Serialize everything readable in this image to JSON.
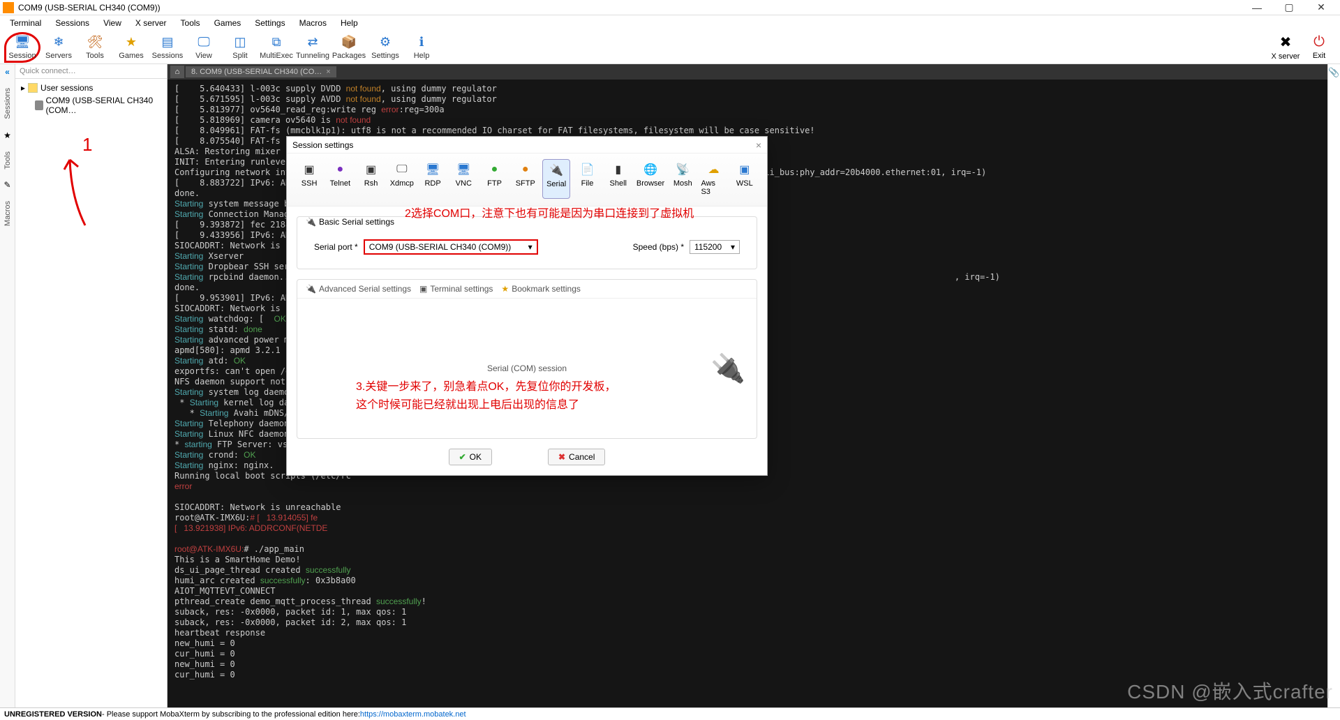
{
  "window": {
    "title": "COM9  (USB-SERIAL CH340 (COM9))"
  },
  "menu": [
    "Terminal",
    "Sessions",
    "View",
    "X server",
    "Tools",
    "Games",
    "Settings",
    "Macros",
    "Help"
  ],
  "toolbar": [
    {
      "label": "Session",
      "color": "#2a78d0"
    },
    {
      "label": "Servers",
      "color": "#2a78d0"
    },
    {
      "label": "Tools",
      "color": "#c06010"
    },
    {
      "label": "Games",
      "color": "#e0a000"
    },
    {
      "label": "Sessions",
      "color": "#2a78d0"
    },
    {
      "label": "View",
      "color": "#2a78d0"
    },
    {
      "label": "Split",
      "color": "#2a78d0"
    },
    {
      "label": "MultiExec",
      "color": "#2a78d0"
    },
    {
      "label": "Tunneling",
      "color": "#2a78d0"
    },
    {
      "label": "Packages",
      "color": "#c06010"
    },
    {
      "label": "Settings",
      "color": "#2a78d0"
    },
    {
      "label": "Help",
      "color": "#2a78d0"
    }
  ],
  "toolbar_right": [
    {
      "label": "X server",
      "color": "#000"
    },
    {
      "label": "Exit",
      "color": "#d02020"
    }
  ],
  "vtabs": [
    "Sessions",
    "Tools",
    "Macros"
  ],
  "sidebar": {
    "quick": "Quick connect…",
    "root": "User sessions",
    "child": "COM9  (USB-SERIAL CH340 (COM…"
  },
  "term_tab": "8. COM9  (USB-SERIAL CH340 (CO…",
  "statusbar": {
    "prefix": "UNREGISTERED VERSION",
    "text": " -   Please support MobaXterm by subscribing to the professional edition here: ",
    "link": "https://mobaxterm.mobatek.net"
  },
  "watermark": "CSDN @嵌入式crafter",
  "dialog": {
    "title": "Session settings",
    "protos": [
      "SSH",
      "Telnet",
      "Rsh",
      "Xdmcp",
      "RDP",
      "VNC",
      "FTP",
      "SFTP",
      "Serial",
      "File",
      "Shell",
      "Browser",
      "Mosh",
      "Aws S3",
      "WSL"
    ],
    "active_proto_index": 8,
    "group_title": "Basic Serial settings",
    "serial_port_label": "Serial port *",
    "serial_port_value": "COM9  (USB-SERIAL CH340 (COM9))",
    "speed_label": "Speed (bps) *",
    "speed_value": "115200",
    "sub_tabs": [
      "Advanced Serial settings",
      "Terminal settings",
      "Bookmark settings"
    ],
    "body_text": "Serial (COM) session",
    "ok": "OK",
    "cancel": "Cancel"
  },
  "annotations": {
    "a1": "1",
    "a2": "2选择COM口，注意下也有可能是因为串口连接到了虚拟机",
    "a3_l1": "3.关键一步来了，别急着点OK，先复位你的开发板，",
    "a3_l2": "这个时候可能已经就出现上电后出现的信息了"
  },
  "term": {
    "raw": "[    5.640433] l-003c supply DVDD |not found|, using dummy regulator\n[    5.671595] l-003c supply AVDD |not found|, using dummy regulator\n[    5.813977] ov5640_read_reg:write reg ~error~:reg=300a\n[    5.818969] camera ov5640 is ~not found~\n[    8.049961] FAT-fs (mmcblk1p1): utf8 is not a recommended IO charset for FAT filesystems, filesystem will be case sensitive!\n[    8.075540] FAT-fs (mmcblk1p1): Volume was ~not properly~ unmounted. Some data may be ~corrupt~. Please run fsck.\nALSA: Restoring mixer settings...\nINIT: Entering runlevel: 5\nConfiguring network interfaces... [    8.843820] fec 20b4000.ethernet eth0: Freescale FEC PHY driver [Generic PHY] (mii_bus:phy_addr=20b4000.ethernet:01, irq=-1)\n[    8.883722] IPv6: ADDRCONF(NETDE\ndone.\n^Starting^ system message bus: dbus.\n^Starting^ Connection Manager\n[    9.393872] fec 2188000.etherne\n[    9.433956] IPv6: ADDRCONF(NETDE\nSIOCADDRT: Network is unreachable\n^Starting^ Xserver\n^Starting^ Dropbear SSH server: drop\n^Starting^ rpcbind daemon...[    9.9                                                                                                                           , irq=-1)\ndone.\n[    9.953901] IPv6: ADDRCONF(NETDE\nSIOCADDRT: Network is unreachable\n^Starting^ watchdog: [  `OK`  ]\n^Starting^ statd: `done`\n^Starting^ advanced power management\napmd[580]: apmd 3.2.1 interfacing w\n^Starting^ atd: `OK`\nexportfs: can't open /etc/exports f\nNFS daemon support not `enabled` in k\n^Starting^ system log daemon...0\n * ^Starting^ kernel log daemon...0\n   * ^Starting^ Avahi mDNS/DNS-SD Daemo\n^Starting^ Telephony daemon\n^Starting^ Linux NFC daemon\n* ^starting^ FTP Server: vsftpd... do\n^Starting^ crond: `OK`\n^Starting^ nginx: nginx.\nRunning local boot scripts (/etc/rc\n~error~\n\nSIOCADDRT: Network is unreachable\nroot@ATK-IMX6U:~# [   13.914055] fe\n[   13.921938] IPv6: ADDRCONF(NETDE\n\nroot@ATK-IMX6U:~# ./app_main\nThis is a SmartHome Demo!\nds_ui_page_thread created `successfully`\nhumi_arc created `successfully`: 0x3b8a00\nAIOT_MQTTEVT_CONNECT\npthread_create demo_mqtt_process_thread `successfully`!\nsuback, res: -0x0000, packet id: 1, max qos: 1\nsuback, res: -0x0000, packet id: 2, max qos: 1\nheartbeat response\nnew_humi = 0\ncur_humi = 0\nnew_humi = 0\ncur_humi = 0"
  }
}
